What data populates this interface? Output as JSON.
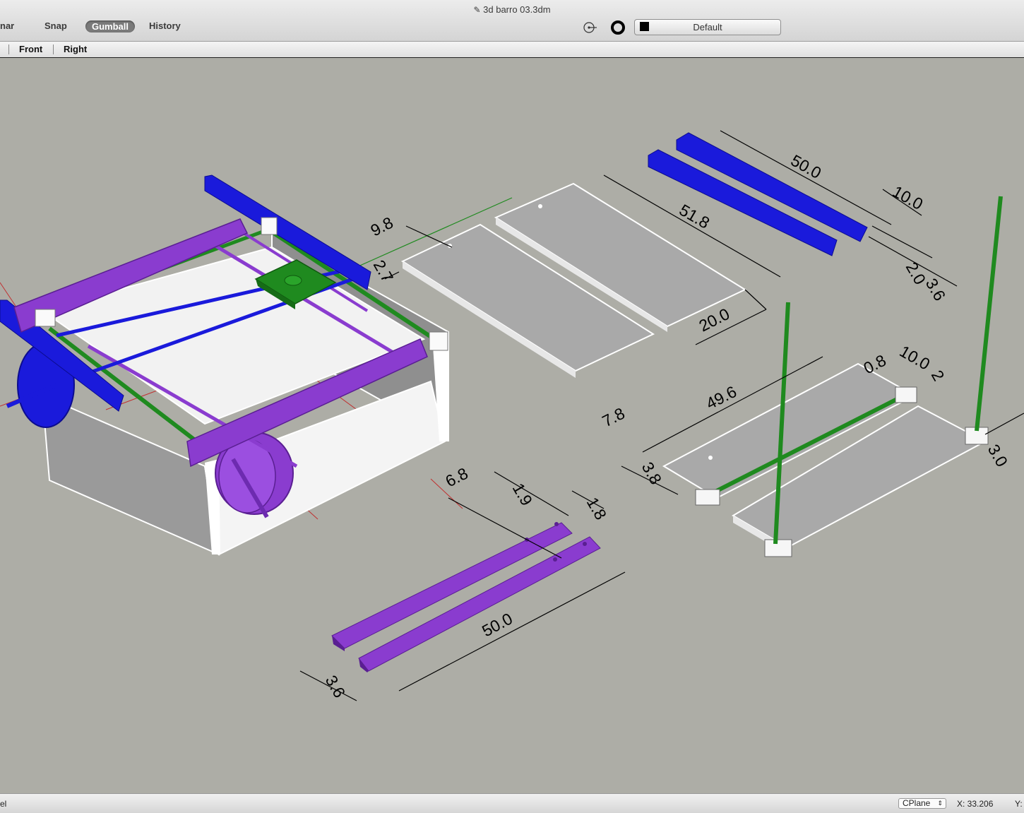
{
  "window": {
    "title": "3d barro 03.3dm"
  },
  "toolbar": {
    "planar_label": "nar",
    "snap_label": "Snap",
    "gumball_label": "Gumball",
    "history_label": "History",
    "layer_name": "Default"
  },
  "views": {
    "front": "Front",
    "right": "Right"
  },
  "dimensions": {
    "d_50_top": "50.0",
    "d_10_top": "10.0",
    "d_2_top": "2.0",
    "d_3_6_top": "3.6",
    "d_51_8": "51.8",
    "d_20_0": "20.0",
    "d_9_8": "9.8",
    "d_2_7": "2.7",
    "d_10_0_right": "10.0",
    "d_0_8_right": "0.8",
    "d_2_right": "2",
    "d_49_6": "49.6",
    "d_7_8": "7.8",
    "d_3_8": "3.8",
    "d_3_0": "3.0",
    "d_6_8": "6.8",
    "d_1_9": "1.9",
    "d_1_8": "1.8",
    "d_50_bottom": "50.0",
    "d_3_6_bottom": "3.6"
  },
  "status": {
    "left_text": "el",
    "cplane_label": "CPlane",
    "x_coord": "X: 33.206",
    "y_label": "Y:"
  },
  "colors": {
    "viewport_bg": "#adada6",
    "blue_part": "#1a1adb",
    "purple_part": "#8a3ccf",
    "green_part": "#1f8a1f",
    "white_part": "#f4f4f4"
  }
}
